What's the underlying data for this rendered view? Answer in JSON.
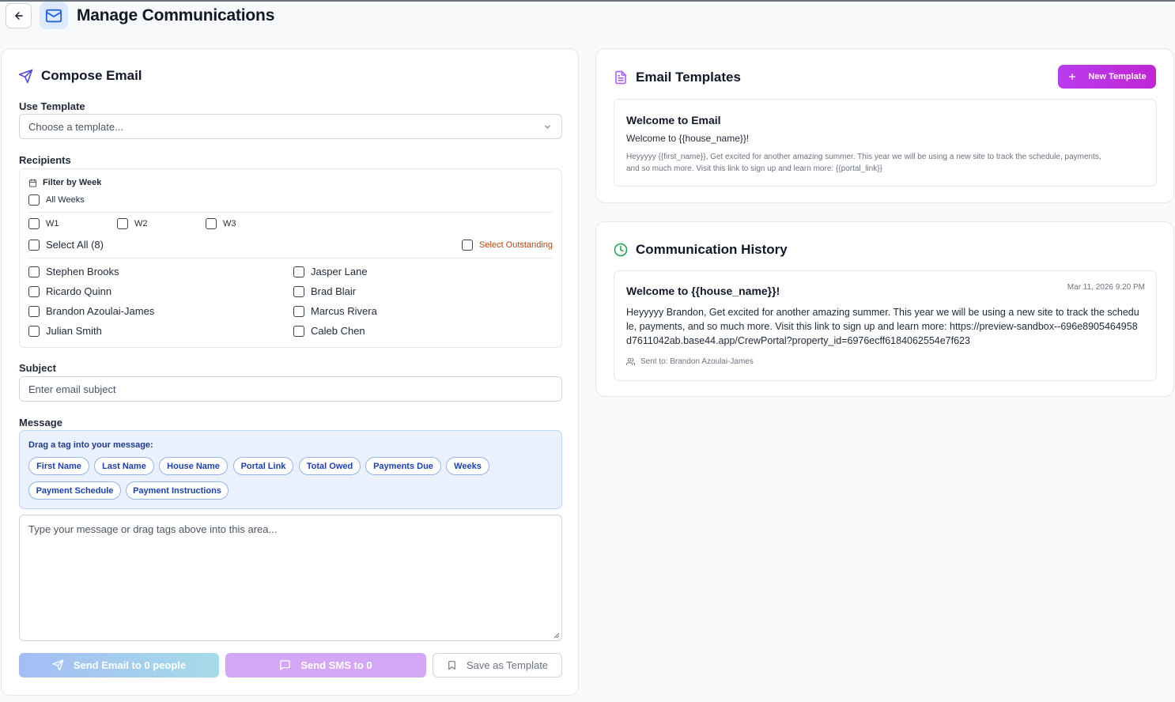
{
  "header": {
    "title": "Manage Communications"
  },
  "compose": {
    "title": "Compose Email",
    "template_label": "Use Template",
    "template_placeholder": "Choose a template...",
    "recipients_label": "Recipients",
    "filter_label": "Filter by Week",
    "all_weeks": "All Weeks",
    "weeks": [
      "W1",
      "W2",
      "W3"
    ],
    "select_all": "Select All (8)",
    "select_outstanding": "Select Outstanding",
    "people_left": [
      "Stephen Brooks",
      "Ricardo Quinn",
      "Brandon Azoulai-James",
      "Julian Smith"
    ],
    "people_right": [
      "Jasper Lane",
      "Brad Blair",
      "Marcus Rivera",
      "Caleb Chen"
    ],
    "subject_label": "Subject",
    "subject_placeholder": "Enter email subject",
    "message_label": "Message",
    "tags_title": "Drag a tag into your message:",
    "tags": [
      "First Name",
      "Last Name",
      "House Name",
      "Portal Link",
      "Total Owed",
      "Payments Due",
      "Weeks",
      "Payment Schedule",
      "Payment Instructions"
    ],
    "message_placeholder": "Type your message or drag tags above into this area...",
    "send_email": "Send Email to 0 people",
    "send_sms": "Send SMS to 0",
    "save_template": "Save as Template"
  },
  "templates": {
    "title": "Email Templates",
    "new_button": "New Template",
    "items": [
      {
        "name": "Welcome to Email",
        "subject": "Welcome to {{house_name}}!",
        "body": "Heyyyyy {{first_name}}, Get excited for another amazing summer. This year we will be using a new site to track the schedule, payments, and so much more. Visit this link to sign up and learn more: {{portal_link}}"
      }
    ]
  },
  "history": {
    "title": "Communication History",
    "items": [
      {
        "subject": "Welcome to {{house_name}}!",
        "timestamp": "Mar 11, 2026 9:20 PM",
        "body": "Heyyyyy Brandon, Get excited for another amazing summer. This year we will be using a new site to track the schedule, payments, and so much more. Visit this link to sign up and learn more: https://preview-sandbox--696e8905464958d7611042ab.base44.app/CrewPortal?property_id=6976ecff6184062554e7f623",
        "sent_to": "Sent to: Brandon Azoulai-James"
      }
    ]
  },
  "colors": {
    "accent_blue": "#2563eb",
    "accent_purple": "#c026d3",
    "outstanding": "#c2410c",
    "history_green": "#16a34a"
  },
  "icons": {
    "back": "arrow-left-icon",
    "header": "mail-icon",
    "compose": "send-icon",
    "templates": "file-text-icon",
    "history": "clock-icon"
  }
}
